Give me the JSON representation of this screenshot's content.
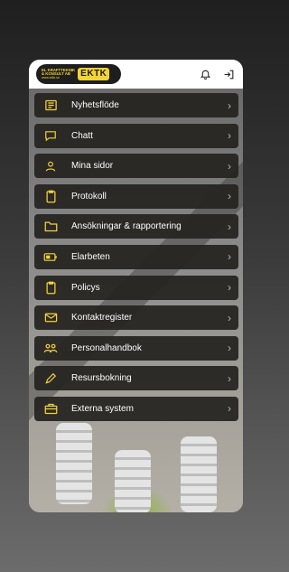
{
  "header": {
    "logo": {
      "line1": "EL KRAFTTEKNIK",
      "line2": "& KONSULT AB",
      "line3": "www.ektk.se",
      "mark": "EKTK"
    },
    "icons": [
      "bell-icon",
      "logout-icon"
    ]
  },
  "colors": {
    "accent": "#f3d33a",
    "menu_bg": "#262421",
    "menu_text": "#ffffff"
  },
  "menu": [
    {
      "label": "Nyhetsflöde",
      "icon": "newspaper-icon"
    },
    {
      "label": "Chatt",
      "icon": "chat-icon"
    },
    {
      "label": "Mina sidor",
      "icon": "user-icon"
    },
    {
      "label": "Protokoll",
      "icon": "clipboard-icon"
    },
    {
      "label": "Ansökningar & rapportering",
      "icon": "folder-icon"
    },
    {
      "label": "Elarbeten",
      "icon": "battery-icon"
    },
    {
      "label": "Policys",
      "icon": "clipboard-icon"
    },
    {
      "label": "Kontaktregister",
      "icon": "mail-icon"
    },
    {
      "label": "Personalhandbok",
      "icon": "people-icon"
    },
    {
      "label": "Resursbokning",
      "icon": "pencil-icon"
    },
    {
      "label": "Externa system",
      "icon": "briefcase-icon"
    }
  ]
}
